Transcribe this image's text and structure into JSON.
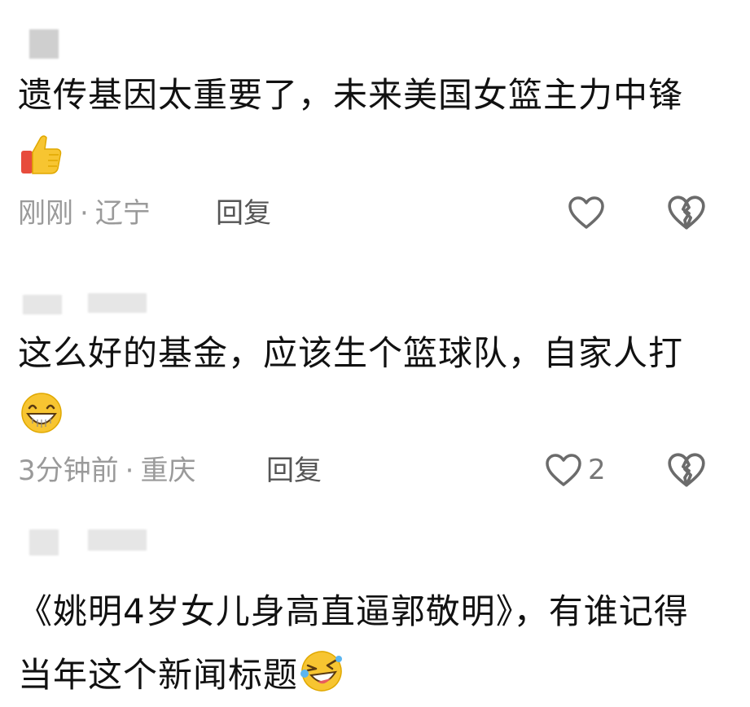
{
  "comments": [
    {
      "text": "遗传基因太重要了，未来美国女篮主力中锋",
      "emoji": "thumbs-up-icon",
      "time": "刚刚",
      "location": "辽宁",
      "reply_label": "回复",
      "like_count": ""
    },
    {
      "text": "这么好的基金，应该生个篮球队，自家人打",
      "emoji": "grinning-face-icon",
      "time": "3分钟前",
      "location": "重庆",
      "reply_label": "回复",
      "like_count": "2"
    },
    {
      "text": "《姚明4岁女儿身高直逼郭敬明》，有谁记得当年这个新闻标题",
      "emoji": "rolling-laughing-icon",
      "time": "",
      "location": "",
      "reply_label": "",
      "like_count": ""
    }
  ],
  "separator": "·",
  "colors": {
    "text": "#111111",
    "meta": "#9a9a9a",
    "icon": "#6b6b6b",
    "emoji_yellow": "#f7c531"
  }
}
